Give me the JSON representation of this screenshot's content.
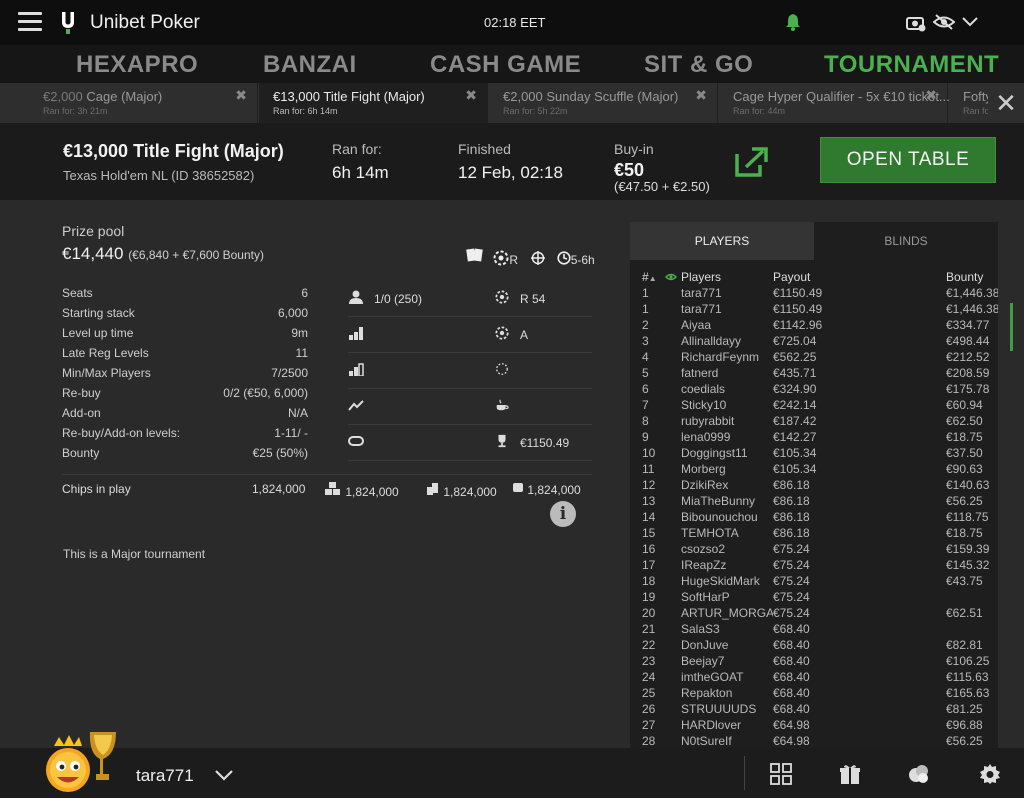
{
  "app": {
    "title": "Unibet Poker",
    "clock": "02:18 EET"
  },
  "nav": [
    {
      "label": "HEXAPRO",
      "active": false
    },
    {
      "label": "BANZAI",
      "active": false
    },
    {
      "label": "CASH GAME",
      "active": false
    },
    {
      "label": "SIT & GO",
      "active": false
    },
    {
      "label": "TOURNAMENT",
      "active": true
    }
  ],
  "tabs": [
    {
      "amount": "€2,000",
      "name": "Cage (Major)",
      "ran": "Ran for: 3h 21m",
      "active": false
    },
    {
      "amount": "",
      "name": "€13,000 Title Fight (Major)",
      "ran": "Ran for: 6h 14m",
      "active": true
    },
    {
      "amount": "",
      "name": "€2,000 Sunday Scuffle (Major)",
      "ran": "Ran for: 5h 22m",
      "active": false
    },
    {
      "amount": "",
      "name": "Cage Hyper Qualifier - 5x €10 ticket...",
      "ran": "Ran for: 44m",
      "active": false
    },
    {
      "amount": "",
      "name": "Fofty",
      "ran": "Ran fo",
      "active": false
    }
  ],
  "tournament": {
    "title": "€13,000 Title Fight (Major)",
    "subtitle": "Texas Hold'em NL (ID 38652582)",
    "ran_for_label": "Ran for:",
    "ran_for": "6h 14m",
    "finished_label": "Finished",
    "finished": "12 Feb, 02:18",
    "buyin_label": "Buy-in",
    "buyin": "€50",
    "buyin_detail": "(€47.50 + €2.50)",
    "open_table": "OPEN TABLE"
  },
  "prize": {
    "label": "Prize pool",
    "value": "€14,440",
    "detail": "(€6,840 + €7,600 Bounty)",
    "badge_r": "R",
    "duration": "5-6h"
  },
  "stats": [
    {
      "k": "Seats",
      "v": "6"
    },
    {
      "k": "Starting stack",
      "v": "6,000"
    },
    {
      "k": "Level up time",
      "v": "9m"
    },
    {
      "k": "Late Reg Levels",
      "v": "11"
    },
    {
      "k": "Min/Max Players",
      "v": "7/2500"
    },
    {
      "k": "Re-buy",
      "v": "0/2 (€50, 6,000)"
    },
    {
      "k": "Add-on",
      "v": "N/A"
    },
    {
      "k": "Re-buy/Add-on levels:",
      "v": "1-11/ -"
    },
    {
      "k": "Bounty",
      "v": "€25 (50%)"
    }
  ],
  "mid_col": [
    "1/0 (250)",
    "",
    "",
    "",
    ""
  ],
  "right_col": [
    "R  54",
    "A",
    "",
    "",
    "€1150.49"
  ],
  "chips": {
    "label": "Chips in play",
    "v1": "1,824,000",
    "v2": "1,824,000",
    "v3": "1,824,000",
    "v4": "1,824,000"
  },
  "note": "This is a Major tournament",
  "panel": {
    "tab_players": "PLAYERS",
    "tab_blinds": "BLINDS",
    "h_num": "#",
    "h_players": "Players",
    "h_payout": "Payout",
    "h_bounty": "Bounty",
    "rows": [
      [
        "1",
        "tara771",
        "€1150.49",
        "€1,446.38"
      ],
      [
        "1",
        "tara771",
        "€1150.49",
        "€1,446.38"
      ],
      [
        "2",
        "Aiyaa",
        "€1142.96",
        "€334.77"
      ],
      [
        "3",
        "Allinalldayy",
        "€725.04",
        "€498.44"
      ],
      [
        "4",
        "RichardFeynm",
        "€562.25",
        "€212.52"
      ],
      [
        "5",
        "fatnerd",
        "€435.71",
        "€208.59"
      ],
      [
        "6",
        "coedials",
        "€324.90",
        "€175.78"
      ],
      [
        "7",
        "Sticky10",
        "€242.14",
        "€60.94"
      ],
      [
        "8",
        "rubyrabbit",
        "€187.42",
        "€62.50"
      ],
      [
        "9",
        "lena0999",
        "€142.27",
        "€18.75"
      ],
      [
        "10",
        "Doggingst11",
        "€105.34",
        "€37.50"
      ],
      [
        "11",
        "Morberg",
        "€105.34",
        "€90.63"
      ],
      [
        "12",
        "DzikiRex",
        "€86.18",
        "€140.63"
      ],
      [
        "13",
        "MiaTheBunny",
        "€86.18",
        "€56.25"
      ],
      [
        "14",
        "Bibounouchou",
        "€86.18",
        "€118.75"
      ],
      [
        "15",
        "TEMHOTA",
        "€86.18",
        "€18.75"
      ],
      [
        "16",
        "csozso2",
        "€75.24",
        "€159.39"
      ],
      [
        "17",
        "IReapZz",
        "€75.24",
        "€145.32"
      ],
      [
        "18",
        "HugeSkidMark",
        "€75.24",
        "€43.75"
      ],
      [
        "19",
        "SoftHarP",
        "€75.24",
        ""
      ],
      [
        "20",
        "ARTUR_MORGAN",
        "€75.24",
        "€62.51"
      ],
      [
        "21",
        "SalaS3",
        "€68.40",
        ""
      ],
      [
        "22",
        "DonJuve",
        "€68.40",
        "€82.81"
      ],
      [
        "23",
        "Beejay7",
        "€68.40",
        "€106.25"
      ],
      [
        "24",
        "imtheGOAT",
        "€68.40",
        "€115.63"
      ],
      [
        "25",
        "Repakton",
        "€68.40",
        "€165.63"
      ],
      [
        "26",
        "STRUUUUDS",
        "€68.40",
        "€81.25"
      ],
      [
        "27",
        "HARDlover",
        "€64.98",
        "€96.88"
      ],
      [
        "28",
        "N0tSureIf",
        "€64.98",
        "€56.25"
      ]
    ]
  },
  "user": {
    "name": "tara771"
  },
  "colors": {
    "accent": "#4caf50",
    "button": "#2f7a2f",
    "bg": "#2a2a2a"
  }
}
